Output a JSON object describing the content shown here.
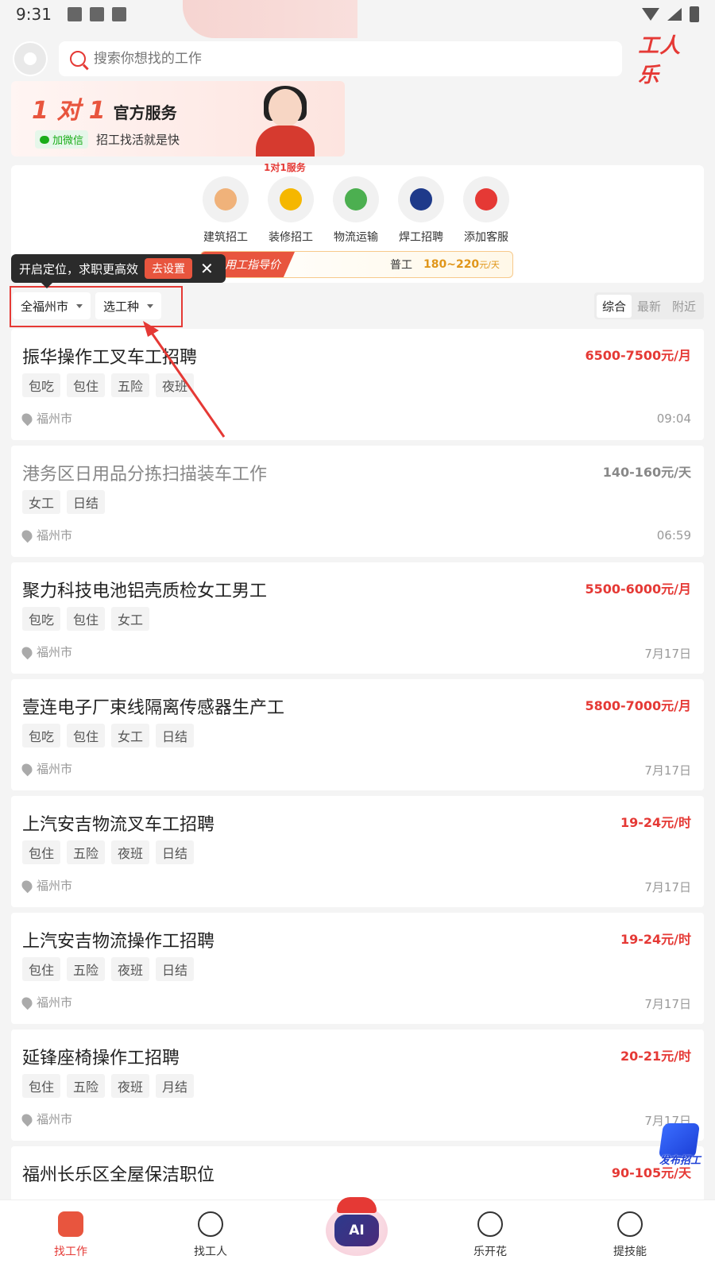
{
  "status_bar": {
    "time": "9:31"
  },
  "header": {
    "search_placeholder": "搜索你想找的工作",
    "logo_text": "工人乐"
  },
  "banner": {
    "headline": "1 对 1",
    "headline_suffix": "官方服务",
    "wechat_label": "加微信",
    "tagline": "招工找活就是快"
  },
  "categories": {
    "badge": "1对1服务",
    "items": [
      {
        "label": "建筑招工",
        "icon": "construction-worker-icon",
        "color": "#f0b27a"
      },
      {
        "label": "装修招工",
        "icon": "renovation-worker-icon",
        "color": "#f5b700"
      },
      {
        "label": "物流运输",
        "icon": "truck-icon",
        "color": "#4caf50"
      },
      {
        "label": "焊工招聘",
        "icon": "welder-icon",
        "color": "#1e3a8a"
      },
      {
        "label": "添加客服",
        "icon": "customer-service-icon",
        "color": "#e53935"
      }
    ],
    "price_guide": {
      "tag": "用工指导价",
      "job": "普工",
      "value": "180~220",
      "unit": "元/天"
    }
  },
  "tooltip": {
    "text": "开启定位，求职更高效",
    "action": "去设置",
    "close": "✕"
  },
  "filter": {
    "city": "全福州市",
    "job_type": "选工种",
    "sort_tabs": [
      "综合",
      "最新",
      "附近"
    ],
    "active_sort": "综合"
  },
  "jobs": [
    {
      "title": "振华操作工叉车工招聘",
      "salary": "6500-7500元/月",
      "tags": [
        "包吃",
        "包住",
        "五险",
        "夜班"
      ],
      "location": "福州市",
      "time": "09:04",
      "visited": false
    },
    {
      "title": "港务区日用品分拣扫描装车工作",
      "salary": "140-160元/天",
      "tags": [
        "女工",
        "日结"
      ],
      "location": "福州市",
      "time": "06:59",
      "visited": true
    },
    {
      "title": "聚力科技电池铝壳质检女工男工",
      "salary": "5500-6000元/月",
      "tags": [
        "包吃",
        "包住",
        "女工"
      ],
      "location": "福州市",
      "time": "7月17日",
      "visited": false
    },
    {
      "title": "壹连电子厂束线隔离传感器生产工",
      "salary": "5800-7000元/月",
      "tags": [
        "包吃",
        "包住",
        "女工",
        "日结"
      ],
      "location": "福州市",
      "time": "7月17日",
      "visited": false
    },
    {
      "title": "上汽安吉物流叉车工招聘",
      "salary": "19-24元/时",
      "tags": [
        "包住",
        "五险",
        "夜班",
        "日结"
      ],
      "location": "福州市",
      "time": "7月17日",
      "visited": false
    },
    {
      "title": "上汽安吉物流操作工招聘",
      "salary": "19-24元/时",
      "tags": [
        "包住",
        "五险",
        "夜班",
        "日结"
      ],
      "location": "福州市",
      "time": "7月17日",
      "visited": false
    },
    {
      "title": "延锋座椅操作工招聘",
      "salary": "20-21元/时",
      "tags": [
        "包住",
        "五险",
        "夜班",
        "月结"
      ],
      "location": "福州市",
      "time": "7月17日",
      "visited": false
    },
    {
      "title": "福州长乐区全屋保洁职位",
      "salary": "90-105元/天",
      "tags": [],
      "location": "",
      "time": "",
      "visited": false
    }
  ],
  "publish_button": {
    "label": "发布招工"
  },
  "bottom_nav": {
    "items": [
      {
        "label": "找工作",
        "icon": "briefcase-icon",
        "active": true
      },
      {
        "label": "找工人",
        "icon": "find-worker-icon",
        "active": false
      },
      {
        "label": "AI",
        "icon": "ai-assistant-icon",
        "active": false
      },
      {
        "label": "乐开花",
        "icon": "play-video-icon",
        "active": false
      },
      {
        "label": "提技能",
        "icon": "skill-icon",
        "active": false
      }
    ]
  },
  "colors": {
    "accent": "#e53935",
    "brand_red": "#e8553e",
    "price_gold": "#e0961a"
  }
}
